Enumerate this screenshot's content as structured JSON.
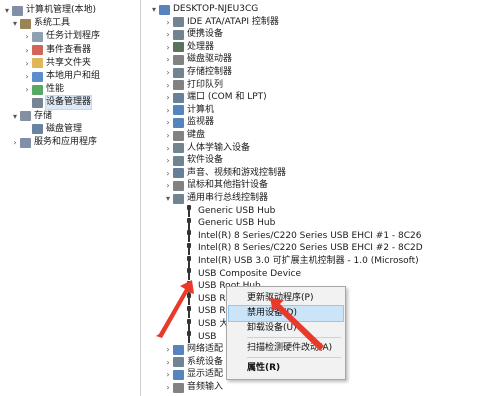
{
  "left_tree": [
    {
      "label": "计算机管理(本地)",
      "twisty": "▾",
      "icon": "computer-management-icon",
      "color": "#6b7a99"
    },
    {
      "label": "系统工具",
      "twisty": "▾",
      "icon": "tools-icon",
      "color": "#8a6d3b"
    },
    {
      "label": "任务计划程序",
      "twisty": "›",
      "icon": "task-scheduler-icon",
      "color": "#7a8fa6"
    },
    {
      "label": "事件查看器",
      "twisty": "›",
      "icon": "event-viewer-icon",
      "color": "#c94a3a"
    },
    {
      "label": "共享文件夹",
      "twisty": "›",
      "icon": "shared-folder-icon",
      "color": "#d9a93b"
    },
    {
      "label": "本地用户和组",
      "twisty": "›",
      "icon": "users-icon",
      "color": "#3f79c4"
    },
    {
      "label": "性能",
      "twisty": "›",
      "icon": "performance-icon",
      "color": "#3a9a4a"
    },
    {
      "label": "设备管理器",
      "twisty": "",
      "icon": "device-manager-icon",
      "color": "#5e6f80"
    },
    {
      "label": "存储",
      "twisty": "▾",
      "icon": "storage-icon",
      "color": "#6d7c8c"
    },
    {
      "label": "磁盘管理",
      "twisty": "",
      "icon": "disk-icon",
      "color": "#4f6f8f"
    },
    {
      "label": "服务和应用程序",
      "twisty": "›",
      "icon": "services-icon",
      "color": "#6b7a99"
    }
  ],
  "right_tree": {
    "root": {
      "label": "DESKTOP-NJEU3CG",
      "icon": "computer-icon"
    },
    "categories": [
      {
        "label": "IDE ATA/ATAPI 控制器",
        "icon": "ide-controller-icon",
        "color": "#5a6e7e"
      },
      {
        "label": "便携设备",
        "icon": "portable-device-icon",
        "color": "#5a6e7e"
      },
      {
        "label": "处理器",
        "icon": "processor-icon",
        "color": "#3d5a3d"
      },
      {
        "label": "磁盘驱动器",
        "icon": "disk-drive-icon",
        "color": "#6c6c6c"
      },
      {
        "label": "存储控制器",
        "icon": "storage-controller-icon",
        "color": "#5a6e7e"
      },
      {
        "label": "打印队列",
        "icon": "printer-icon",
        "color": "#6c6c6c"
      },
      {
        "label": "端口 (COM 和 LPT)",
        "icon": "port-icon",
        "color": "#4d6a86"
      },
      {
        "label": "计算机",
        "icon": "computer-icon",
        "color": "#3a6fb0"
      },
      {
        "label": "监视器",
        "icon": "monitor-icon",
        "color": "#3a6fb0"
      },
      {
        "label": "键盘",
        "icon": "keyboard-icon",
        "color": "#6c6c6c"
      },
      {
        "label": "人体学输入设备",
        "icon": "hid-icon",
        "color": "#5a6e7e"
      },
      {
        "label": "软件设备",
        "icon": "software-device-icon",
        "color": "#5a6e7e"
      },
      {
        "label": "声音、视频和游戏控制器",
        "icon": "sound-icon",
        "color": "#4a6a8a"
      },
      {
        "label": "鼠标和其他指针设备",
        "icon": "mouse-icon",
        "color": "#6c6c6c"
      },
      {
        "label": "通用串行总线控制器",
        "icon": "usb-controller-icon",
        "color": "#5a6e7e",
        "expanded": true
      }
    ],
    "usb_devices": [
      "Generic USB Hub",
      "Generic USB Hub",
      "Intel(R) 8 Series/C220 Series USB EHCI #1 - 8C26",
      "Intel(R) 8 Series/C220 Series USB EHCI #2 - 8C2D",
      "Intel(R) USB 3.0 可扩展主机控制器 - 1.0 (Microsoft)",
      "USB Composite Device",
      "USB Root Hub",
      "USB R",
      "USB R",
      "USB 大",
      "USB"
    ],
    "trailing": [
      {
        "label": "网络适配",
        "icon": "network-icon",
        "color": "#3a6fb0"
      },
      {
        "label": "系统设备",
        "icon": "system-device-icon",
        "color": "#5a6e7e"
      },
      {
        "label": "显示适配",
        "icon": "display-adapter-icon",
        "color": "#3a6fb0"
      },
      {
        "label": "音频输入",
        "icon": "audio-icon",
        "color": "#6c6c6c"
      }
    ]
  },
  "context_menu": {
    "items": [
      {
        "label": "更新驱动程序(P)"
      },
      {
        "label": "禁用设备(D)",
        "highlighted": true
      },
      {
        "label": "卸载设备(U)"
      },
      {
        "label": "扫描检测硬件改动(A)"
      },
      {
        "label": "属性(R)",
        "bold": true
      }
    ]
  },
  "accent": {
    "annotation_red": "#e8392b",
    "selection": "#cce4f7"
  }
}
